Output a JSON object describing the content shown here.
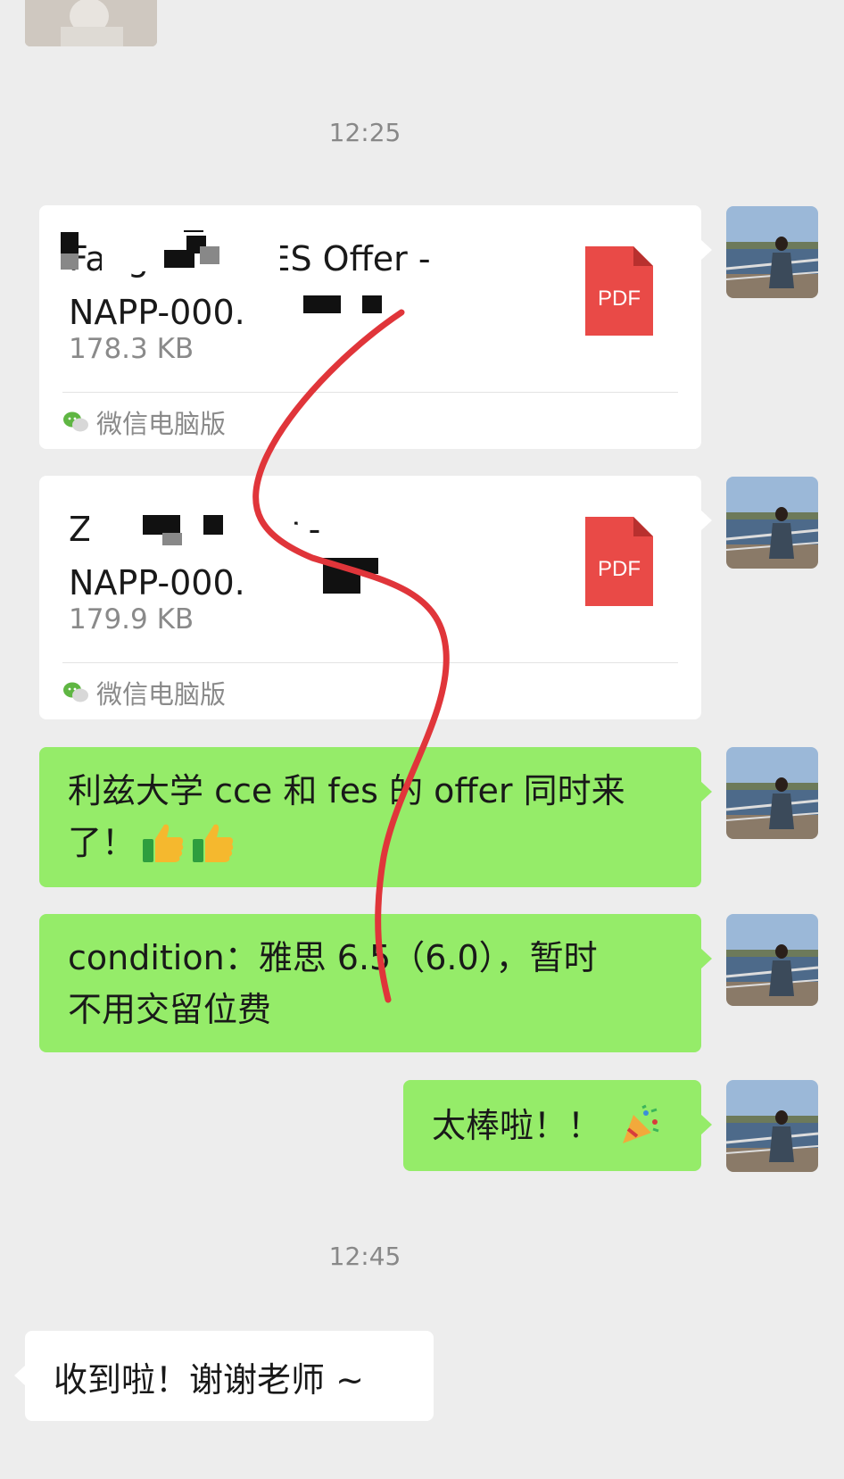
{
  "timestamps": [
    "12:25",
    "12:45"
  ],
  "files": [
    {
      "name_line1": "Fang Yafei FES Offer -",
      "name_line2": "NAPP-000...",
      "size": "178.3 KB",
      "icon_label": "PDF",
      "source": "微信电脑版"
    },
    {
      "name_line1": "Z... RCE Offer -",
      "name_line2": "NAPP-000...",
      "size": "179.9 KB",
      "icon_label": "PDF",
      "source": "微信电脑版"
    }
  ],
  "messages": {
    "offer_news_line1": "利兹大学 cce 和 fes 的 offer 同时来",
    "offer_news_line2": "了！",
    "condition_line1": "condition：雅思 6.5（6.0），暂时",
    "condition_line2": "不用交留位费",
    "congrats": "太棒啦！！",
    "reply": "收到啦！谢谢老师 ~"
  },
  "emoji": [
    "thumbs-up",
    "thumbs-up",
    "party-popper"
  ],
  "colors": {
    "background": "#ededed",
    "outgoing_bubble": "#95ec69",
    "incoming_bubble": "#ffffff",
    "pdf_icon": "#e94a47",
    "annotation_stroke": "#e0353a"
  }
}
